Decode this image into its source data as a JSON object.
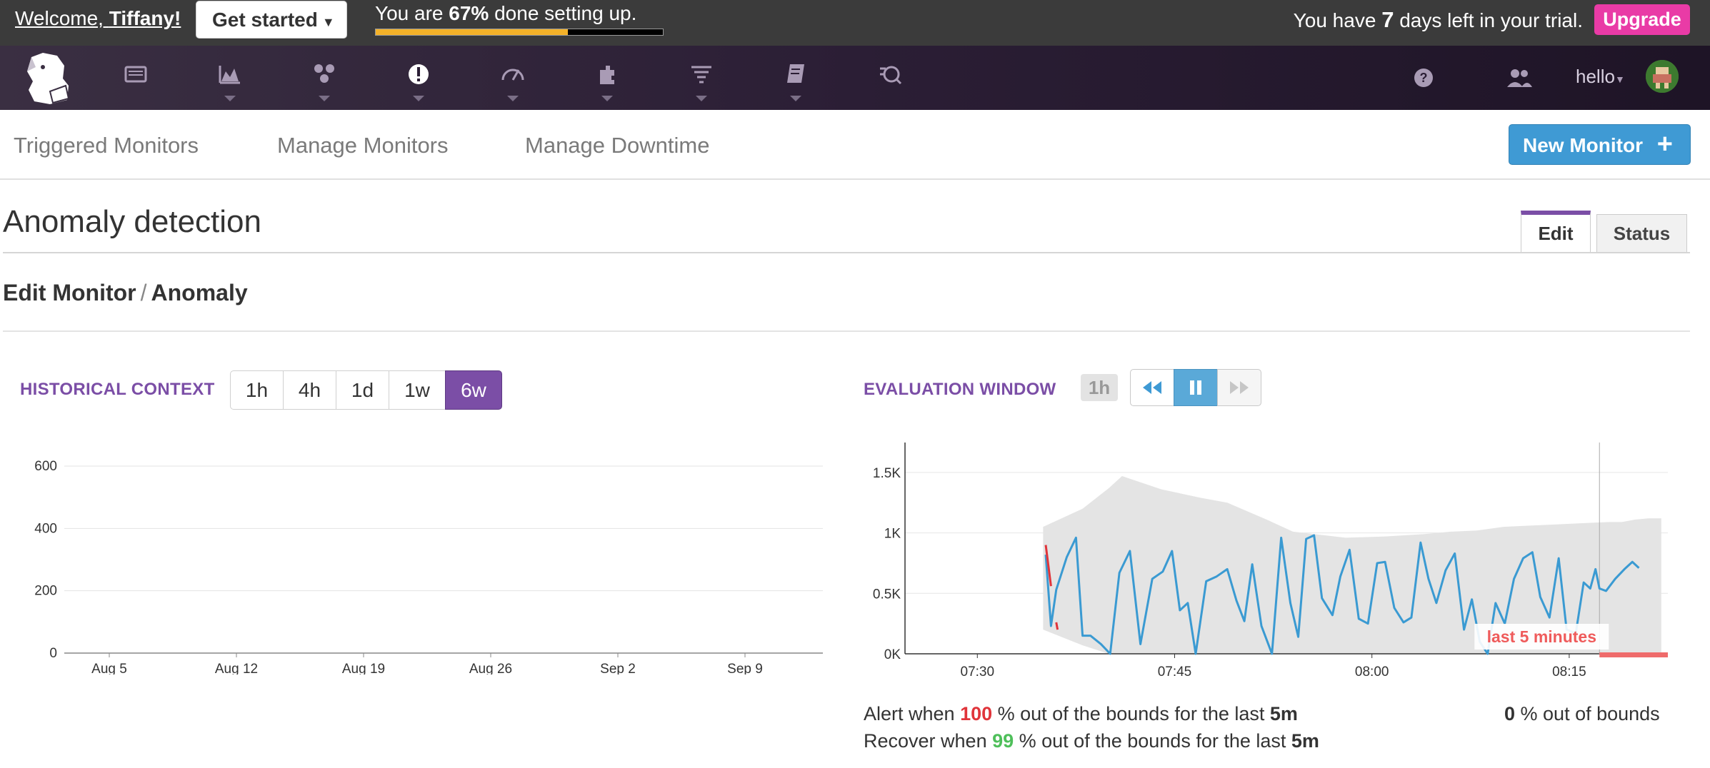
{
  "topbar": {
    "welcome_prefix": "Welcome, ",
    "user_name": "Tiffany!",
    "get_started_label": "Get started",
    "setup_prefix": "You are ",
    "setup_percent": "67%",
    "setup_suffix": " done setting up.",
    "setup_progress": 0.67,
    "trial_prefix": "You have ",
    "trial_days": "7",
    "trial_suffix": " days left in your trial.",
    "upgrade_label": "Upgrade"
  },
  "nav": {
    "icons": [
      "dashboards-icon",
      "metrics-icon",
      "integrations-icon",
      "monitors-icon",
      "apm-icon",
      "infrastructure-icon",
      "logs-icon",
      "notebooks-icon",
      "watchdog-icon"
    ],
    "help_icon": "help-icon",
    "team_icon": "team-icon",
    "user_menu_label": "hello"
  },
  "subnav": {
    "triggered": "Triggered Monitors",
    "manage": "Manage Monitors",
    "downtime": "Manage Downtime",
    "new_monitor": "New Monitor"
  },
  "page": {
    "title": "Anomaly detection",
    "tab_edit": "Edit",
    "tab_status": "Status",
    "breadcrumb_parent": "Edit Monitor",
    "breadcrumb_sep": "/",
    "breadcrumb_current": "Anomaly"
  },
  "historical": {
    "label": "HISTORICAL CONTEXT",
    "ranges": [
      "1h",
      "4h",
      "1d",
      "1w",
      "6w"
    ],
    "selected": "6w"
  },
  "evaluation": {
    "label": "EVALUATION WINDOW",
    "window": "1h"
  },
  "colors": {
    "accent_purple": "#7b4ea6",
    "primary_blue": "#3f9ad4",
    "upgrade_pink": "#e93ba6",
    "alert_red": "#e0343a",
    "recover_green": "#4ebf5a",
    "series_blue": "#3a9ad2",
    "band_grey": "#e4e4e4"
  },
  "chart_data": [
    {
      "type": "line",
      "y_ticks": [
        0,
        200,
        400,
        600
      ],
      "ylim": [
        0,
        600
      ],
      "x_ticks": [
        "Aug 5",
        "Aug 12",
        "Aug 19",
        "Aug 26",
        "Sep 2",
        "Sep 9"
      ],
      "series": []
    },
    {
      "type": "line",
      "y_ticks": [
        "0K",
        "0.5K",
        "1K",
        "1.5K"
      ],
      "ylim": [
        0,
        1700
      ],
      "x_ticks": [
        "07:30",
        "07:45",
        "08:00",
        "08:15"
      ],
      "xlim_minutes": [
        24.5,
        82.5
      ],
      "annotation": "last 5 minutes",
      "series": [
        {
          "values_x": [
            35.2,
            35.6,
            36.0,
            36.8,
            37.5,
            38.0,
            38.6,
            39.4,
            40.1,
            40.8,
            41.6,
            42.4,
            43.3,
            44.1,
            44.8,
            45.4,
            46.0,
            46.6,
            47.4,
            48.2,
            49.0,
            49.7,
            50.3,
            50.9,
            51.6,
            52.4,
            53.1,
            53.8,
            54.4,
            55.0,
            55.6,
            56.2,
            57.0,
            57.6,
            58.3,
            59.0,
            59.7,
            60.4,
            61.0,
            61.7,
            62.4,
            63.0,
            63.7,
            64.3,
            64.9,
            65.6,
            66.3,
            67.0,
            67.6,
            68.2,
            68.8,
            69.4,
            70.1,
            70.8,
            71.5,
            72.2,
            72.8,
            73.5,
            74.2,
            74.8,
            75.5,
            76.1,
            76.6,
            77.0,
            77.3,
            77.8,
            78.5,
            79.2,
            79.8,
            80.3
          ],
          "values_y": [
            820,
            230,
            530,
            800,
            960,
            150,
            150,
            80,
            0,
            670,
            850,
            80,
            620,
            680,
            850,
            360,
            420,
            0,
            600,
            640,
            700,
            440,
            270,
            740,
            230,
            0,
            960,
            420,
            140,
            950,
            980,
            460,
            320,
            640,
            860,
            290,
            250,
            750,
            760,
            380,
            260,
            300,
            920,
            620,
            420,
            690,
            830,
            200,
            450,
            100,
            0,
            420,
            250,
            620,
            790,
            840,
            470,
            300,
            790,
            200,
            170,
            590,
            540,
            700,
            540,
            520,
            620,
            700,
            760,
            710
          ]
        }
      ],
      "band_upper": [
        1050,
        1200,
        1370,
        1470,
        1360,
        1290,
        1250,
        1110,
        1010,
        960,
        970,
        990,
        1010,
        1020,
        1050,
        1060,
        1070,
        1080,
        1090,
        1090,
        1110,
        1120,
        1120
      ],
      "band_lower": [
        200,
        70,
        0,
        0,
        0,
        0,
        0,
        0,
        0,
        0,
        0,
        0,
        0,
        0,
        0,
        0,
        0,
        0,
        0,
        0,
        0,
        0,
        0
      ],
      "band_x": [
        35.0,
        38.0,
        40.0,
        41.0,
        44.0,
        47.0,
        49.0,
        52.0,
        54.0,
        58.0,
        61.0,
        64.0,
        66.0,
        68.0,
        70.0,
        72.0,
        74.0,
        76.0,
        78.0,
        79.0,
        80.0,
        81.0,
        82.0
      ]
    }
  ],
  "rules": {
    "alert_prefix": "Alert when ",
    "alert_pct": "100",
    "alert_mid": " % out of the bounds for the last ",
    "alert_window": "5m",
    "recover_prefix": "Recover when ",
    "recover_pct": "99",
    "recover_mid": " % out of the bounds for the last ",
    "recover_window": "5m",
    "oob_value": "0",
    "oob_suffix": " % out of bounds"
  }
}
